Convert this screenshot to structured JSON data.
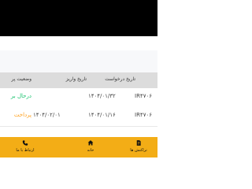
{
  "table": {
    "headers": {
      "status": "وضعیت پر",
      "payment_date": "تاریخ واریز",
      "request_date": "تاریخ درخواست"
    },
    "rows": [
      {
        "code": "IR۴۷۰۶",
        "request_date": "۱۴۰۴/۰۱/۳۲",
        "payment_date": "",
        "status": "درحال بر"
      },
      {
        "code": "IR۴۷۰۶",
        "request_date": "۱۴۰۴/۰۱/۱۶",
        "payment_date": "۱۴۰۴/۰۲/۰۱",
        "status": "پرداخت"
      }
    ]
  },
  "bottom_nav": {
    "items": [
      {
        "label": "ارتباط با ما",
        "icon": "phone-icon"
      },
      {
        "label": "خانه",
        "icon": "home-icon"
      },
      {
        "label": "تراکنش ها",
        "icon": "document-icon"
      }
    ]
  },
  "colors": {
    "pending_status": "#19c36e",
    "paid_status": "#ff9f1a",
    "bottom_bar": "#f3ad16"
  }
}
